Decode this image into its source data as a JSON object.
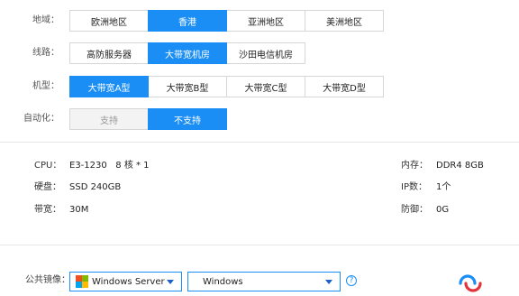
{
  "region": {
    "label": "地域：",
    "options": [
      "欧洲地区",
      "香港",
      "亚洲地区",
      "美洲地区"
    ],
    "selected": "香港"
  },
  "line": {
    "label": "线路：",
    "options": [
      "高防服务器",
      "大带宽机房",
      "沙田电信机房"
    ],
    "selected": "大带宽机房"
  },
  "model": {
    "label": "机型：",
    "options": [
      "大带宽A型",
      "大带宽B型",
      "大带宽C型",
      "大带宽D型"
    ],
    "selected": "大带宽A型"
  },
  "automation": {
    "label": "自动化：",
    "options": [
      "支持",
      "不支持"
    ],
    "selected": "不支持",
    "disabled": [
      "支持"
    ]
  },
  "specs": {
    "cpu_label": "CPU：",
    "cpu_value": "E3-1230   8 核 * 1",
    "disk_label": "硬盘：",
    "disk_value": "SSD 240GB",
    "bandwidth_label": "带宽：",
    "bandwidth_value": "30M",
    "memory_label": "内存：",
    "memory_value": "DDR4 8GB",
    "ip_label": "IP数：",
    "ip_value": "1个",
    "defense_label": "防御：",
    "defense_value": "0G"
  },
  "mirror": {
    "label": "公共镜像：",
    "os_family": "Windows Server",
    "os_version": "Windows",
    "help": "?"
  },
  "colors": {
    "accent": "#1a8ef5",
    "disabled_bg": "#f3f3f3"
  }
}
